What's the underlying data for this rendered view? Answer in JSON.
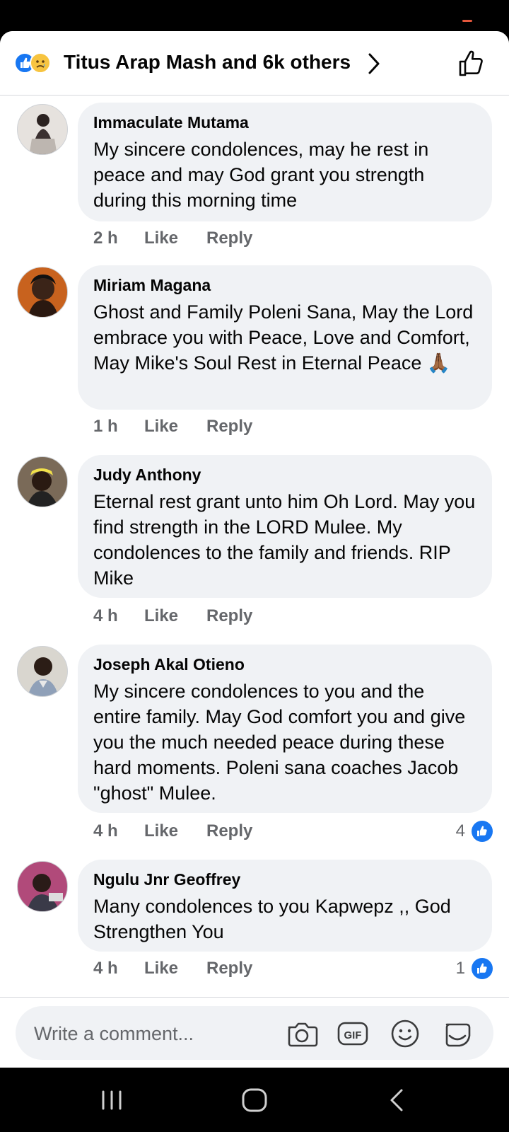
{
  "header": {
    "title": "Titus Arap Mash and 6k others"
  },
  "comments": [
    {
      "author": "Immaculate Mutama",
      "text": "My sincere condolences, may he rest in peace and may God grant you strength during this morning time",
      "time": "2 h",
      "like": "Like",
      "reply": "Reply",
      "likes": ""
    },
    {
      "author": "Miriam Magana",
      "text": "Ghost and Family Poleni Sana, May the Lord embrace you with Peace, Love and Comfort, May Mike's Soul Rest in Eternal Peace 🙏🏾",
      "time": "1 h",
      "like": "Like",
      "reply": "Reply",
      "likes": ""
    },
    {
      "author": "Judy Anthony",
      "text": "Eternal rest grant unto him Oh Lord. May you find strength in the LORD Mulee. My condolences to the family and friends. RIP Mike",
      "time": "4 h",
      "like": "Like",
      "reply": "Reply",
      "likes": ""
    },
    {
      "author": "Joseph Akal Otieno",
      "text": "My sincere condolences to you and the entire family. May God comfort you and give you the much needed peace during these hard moments. Poleni sana coaches Jacob \"ghost\" Mulee.",
      "time": "4 h",
      "like": "Like",
      "reply": "Reply",
      "likes": "4"
    },
    {
      "author": "Ngulu Jnr Geoffrey",
      "text": "Many condolences to you Kapwepz ,, God Strengthen You",
      "time": "4 h",
      "like": "Like",
      "reply": "Reply",
      "likes": "1"
    }
  ],
  "composer": {
    "placeholder": "Write a comment..."
  },
  "colors": {
    "accent": "#1877f2",
    "bubble": "#f0f2f5",
    "meta_text": "#65676b"
  }
}
